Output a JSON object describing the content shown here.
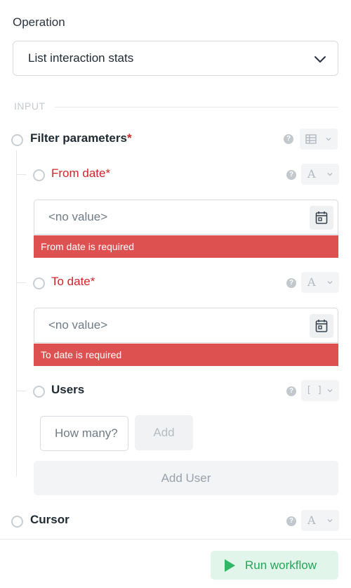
{
  "operation": {
    "label": "Operation",
    "selected": "List interaction stats",
    "chevron_icon": "chevron-down-icon"
  },
  "section": {
    "title": "INPUT"
  },
  "fields": {
    "filter": {
      "label": "Filter parameters",
      "required_mark": "*",
      "type_icon": "table-icon"
    },
    "from_date": {
      "label": "From date",
      "required_mark": "*",
      "type_glyph": "A",
      "placeholder": "<no value>",
      "error": "From date is required"
    },
    "to_date": {
      "label": "To date",
      "required_mark": "*",
      "type_glyph": "A",
      "placeholder": "<no value>",
      "error": "To date is required"
    },
    "users": {
      "label": "Users",
      "type_glyph": "[ ]",
      "input_placeholder": "How many?",
      "add_label": "Add",
      "add_user_label": "Add User"
    },
    "cursor": {
      "label": "Cursor",
      "type_glyph": "A"
    }
  },
  "help_glyph": "?",
  "footer": {
    "run_label": "Run workflow"
  },
  "colors": {
    "error": "#de5151",
    "required": "#d0262b",
    "run_green": "#24a558"
  }
}
